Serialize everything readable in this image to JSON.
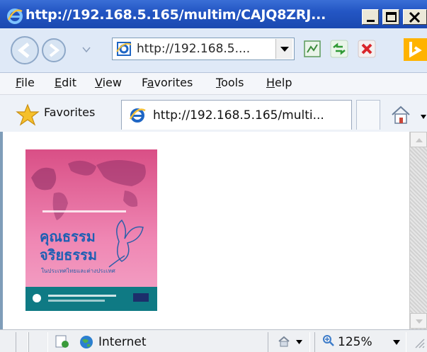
{
  "window": {
    "title": "http://192.168.5.165/multim/CAJQ8ZRJ...",
    "controls": {
      "minimize": "_",
      "maximize": "□",
      "close": "X"
    }
  },
  "navigation": {
    "address": "http://192.168.5....",
    "icons": [
      "back-icon",
      "forward-icon",
      "compatibility-view-icon",
      "refresh-icon",
      "stop-icon",
      "bing-search-icon"
    ]
  },
  "menu": {
    "items": [
      {
        "key": "F",
        "rest": "ile"
      },
      {
        "key": "E",
        "rest": "dit"
      },
      {
        "key": "V",
        "rest": "iew"
      },
      {
        "pre": "F",
        "key": "a",
        "rest": "vorites"
      },
      {
        "key": "T",
        "rest": "ools"
      },
      {
        "key": "H",
        "rest": "elp"
      }
    ]
  },
  "favorites_bar": {
    "label": "Favorites",
    "tab_title": "http://192.168.5.165/multi..."
  },
  "content": {
    "cover_image": {
      "title_line1": "คุณธรรม",
      "title_line2": "จริยธรรม",
      "subtitle": "ในประเทศไทยและต่างประเทศ"
    }
  },
  "status": {
    "zone": "Internet",
    "zoom": "125%"
  },
  "colors": {
    "titlebar": "#2456c4",
    "cover_pink": "#e8578f",
    "cover_teal": "#0f7a84"
  }
}
